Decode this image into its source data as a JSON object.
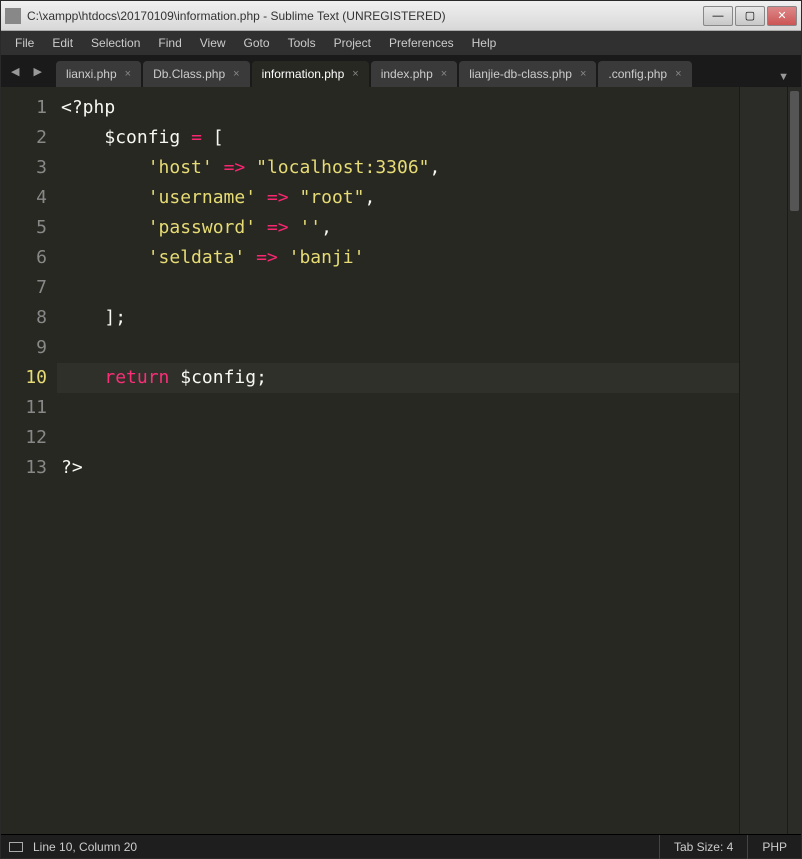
{
  "window": {
    "title": "C:\\xampp\\htdocs\\20170109\\information.php - Sublime Text (UNREGISTERED)"
  },
  "menu": {
    "items": [
      "File",
      "Edit",
      "Selection",
      "Find",
      "View",
      "Goto",
      "Tools",
      "Project",
      "Preferences",
      "Help"
    ]
  },
  "tabs": {
    "items": [
      {
        "label": "lianxi.php",
        "active": false
      },
      {
        "label": "Db.Class.php",
        "active": false
      },
      {
        "label": "information.php",
        "active": true
      },
      {
        "label": "index.php",
        "active": false
      },
      {
        "label": "lianjie-db-class.php",
        "active": false
      },
      {
        "label": ".config.php",
        "active": false
      }
    ]
  },
  "code": {
    "lines": [
      [
        {
          "t": "tag",
          "v": "<?php"
        }
      ],
      [
        {
          "t": "pad",
          "v": "    "
        },
        {
          "t": "var",
          "v": "$config"
        },
        {
          "t": "pad",
          "v": " "
        },
        {
          "t": "op",
          "v": "="
        },
        {
          "t": "pad",
          "v": " "
        },
        {
          "t": "punc",
          "v": "["
        }
      ],
      [
        {
          "t": "pad",
          "v": "        "
        },
        {
          "t": "str",
          "v": "'host'"
        },
        {
          "t": "pad",
          "v": " "
        },
        {
          "t": "op",
          "v": "=>"
        },
        {
          "t": "pad",
          "v": " "
        },
        {
          "t": "str",
          "v": "\"localhost:3306\""
        },
        {
          "t": "punc",
          "v": ","
        }
      ],
      [
        {
          "t": "pad",
          "v": "        "
        },
        {
          "t": "str",
          "v": "'username'"
        },
        {
          "t": "pad",
          "v": " "
        },
        {
          "t": "op",
          "v": "=>"
        },
        {
          "t": "pad",
          "v": " "
        },
        {
          "t": "str",
          "v": "\"root\""
        },
        {
          "t": "punc",
          "v": ","
        }
      ],
      [
        {
          "t": "pad",
          "v": "        "
        },
        {
          "t": "str",
          "v": "'password'"
        },
        {
          "t": "pad",
          "v": " "
        },
        {
          "t": "op",
          "v": "=>"
        },
        {
          "t": "pad",
          "v": " "
        },
        {
          "t": "str",
          "v": "''"
        },
        {
          "t": "punc",
          "v": ","
        }
      ],
      [
        {
          "t": "pad",
          "v": "        "
        },
        {
          "t": "str",
          "v": "'seldata'"
        },
        {
          "t": "pad",
          "v": " "
        },
        {
          "t": "op",
          "v": "=>"
        },
        {
          "t": "pad",
          "v": " "
        },
        {
          "t": "str",
          "v": "'banji'"
        }
      ],
      [],
      [
        {
          "t": "pad",
          "v": "    "
        },
        {
          "t": "punc",
          "v": "];"
        }
      ],
      [],
      [
        {
          "t": "pad",
          "v": "    "
        },
        {
          "t": "kw",
          "v": "return"
        },
        {
          "t": "pad",
          "v": " "
        },
        {
          "t": "var",
          "v": "$config"
        },
        {
          "t": "punc",
          "v": ";"
        }
      ],
      [],
      [],
      [
        {
          "t": "tag",
          "v": "?>"
        }
      ]
    ],
    "current_line_index": 9
  },
  "status": {
    "cursor": "Line 10, Column 20",
    "tab_size": "Tab Size: 4",
    "syntax": "PHP"
  }
}
